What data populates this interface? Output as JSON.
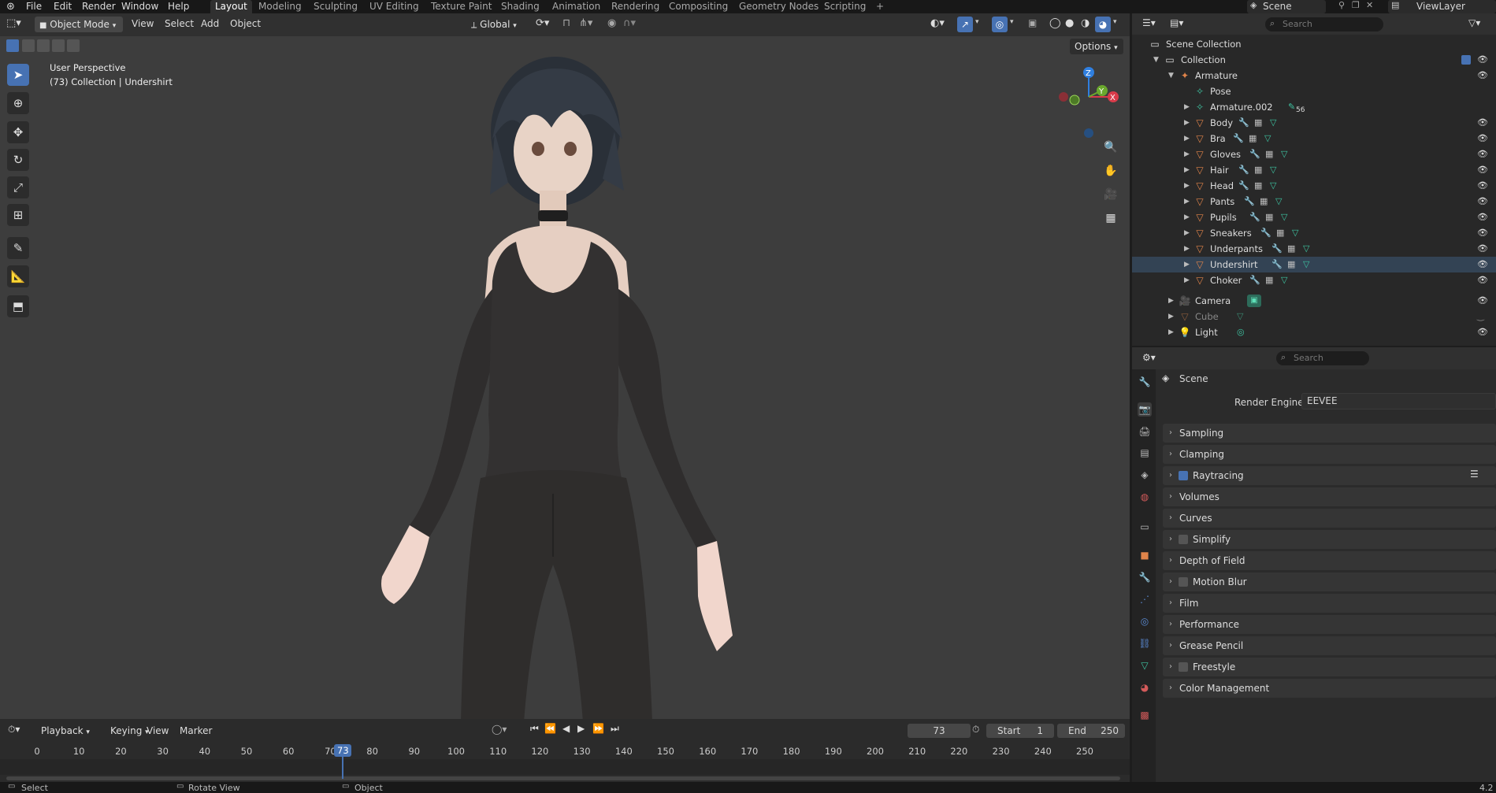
{
  "topbar": {
    "menus": [
      "File",
      "Edit",
      "Render",
      "Window",
      "Help"
    ],
    "workspaces": [
      "Layout",
      "Modeling",
      "Sculpting",
      "UV Editing",
      "Texture Paint",
      "Shading",
      "Animation",
      "Rendering",
      "Compositing",
      "Geometry Nodes",
      "Scripting"
    ],
    "active_workspace": "Layout",
    "add_tab": "+",
    "scene": "Scene",
    "view_layer": "ViewLayer"
  },
  "viewport": {
    "mode": "Object Mode",
    "menus": [
      "View",
      "Select",
      "Add",
      "Object"
    ],
    "orientation": "Global",
    "options": "Options",
    "overlay_title": "User Perspective",
    "overlay_sub": "(73) Collection | Undershirt",
    "gizmo_axes": {
      "z": "Z",
      "y": "Y",
      "x": "X"
    }
  },
  "outliner": {
    "search_placeholder": "Search",
    "root": "Scene Collection",
    "collection": "Collection",
    "armature": "Armature",
    "pose": "Pose",
    "armature002": "Armature.002",
    "armature002_badge": "56",
    "meshes": [
      "Body",
      "Bra",
      "Gloves",
      "Hair",
      "Head",
      "Pants",
      "Pupils",
      "Sneakers",
      "Underpants",
      "Undershirt",
      "Choker"
    ],
    "camera": "Camera",
    "cube": "Cube",
    "light": "Light"
  },
  "properties": {
    "search_placeholder": "Search",
    "context": "Scene",
    "render_engine_label": "Render Engine",
    "render_engine": "EEVEE",
    "panels": [
      {
        "label": "Sampling",
        "checkbox": null
      },
      {
        "label": "Clamping",
        "checkbox": null
      },
      {
        "label": "Raytracing",
        "checkbox": true
      },
      {
        "label": "Volumes",
        "checkbox": null
      },
      {
        "label": "Curves",
        "checkbox": null
      },
      {
        "label": "Simplify",
        "checkbox": false
      },
      {
        "label": "Depth of Field",
        "checkbox": null
      },
      {
        "label": "Motion Blur",
        "checkbox": false
      },
      {
        "label": "Film",
        "checkbox": null
      },
      {
        "label": "Performance",
        "checkbox": null
      },
      {
        "label": "Grease Pencil",
        "checkbox": null
      },
      {
        "label": "Freestyle",
        "checkbox": false
      },
      {
        "label": "Color Management",
        "checkbox": null
      }
    ]
  },
  "timeline": {
    "menus": [
      "Playback",
      "Keying",
      "View",
      "Marker"
    ],
    "current_frame": "73",
    "start_label": "Start",
    "start": "1",
    "end_label": "End",
    "end": "250",
    "ticks": [
      "0",
      "10",
      "20",
      "30",
      "40",
      "50",
      "60",
      "70",
      "80",
      "90",
      "100",
      "110",
      "120",
      "130",
      "140",
      "150",
      "160",
      "170",
      "180",
      "190",
      "200",
      "210",
      "220",
      "230",
      "240",
      "250"
    ],
    "playhead": "73"
  },
  "statusbar": {
    "select": "Select",
    "rotate": "Rotate View",
    "object": "Object",
    "version": "4.2"
  }
}
